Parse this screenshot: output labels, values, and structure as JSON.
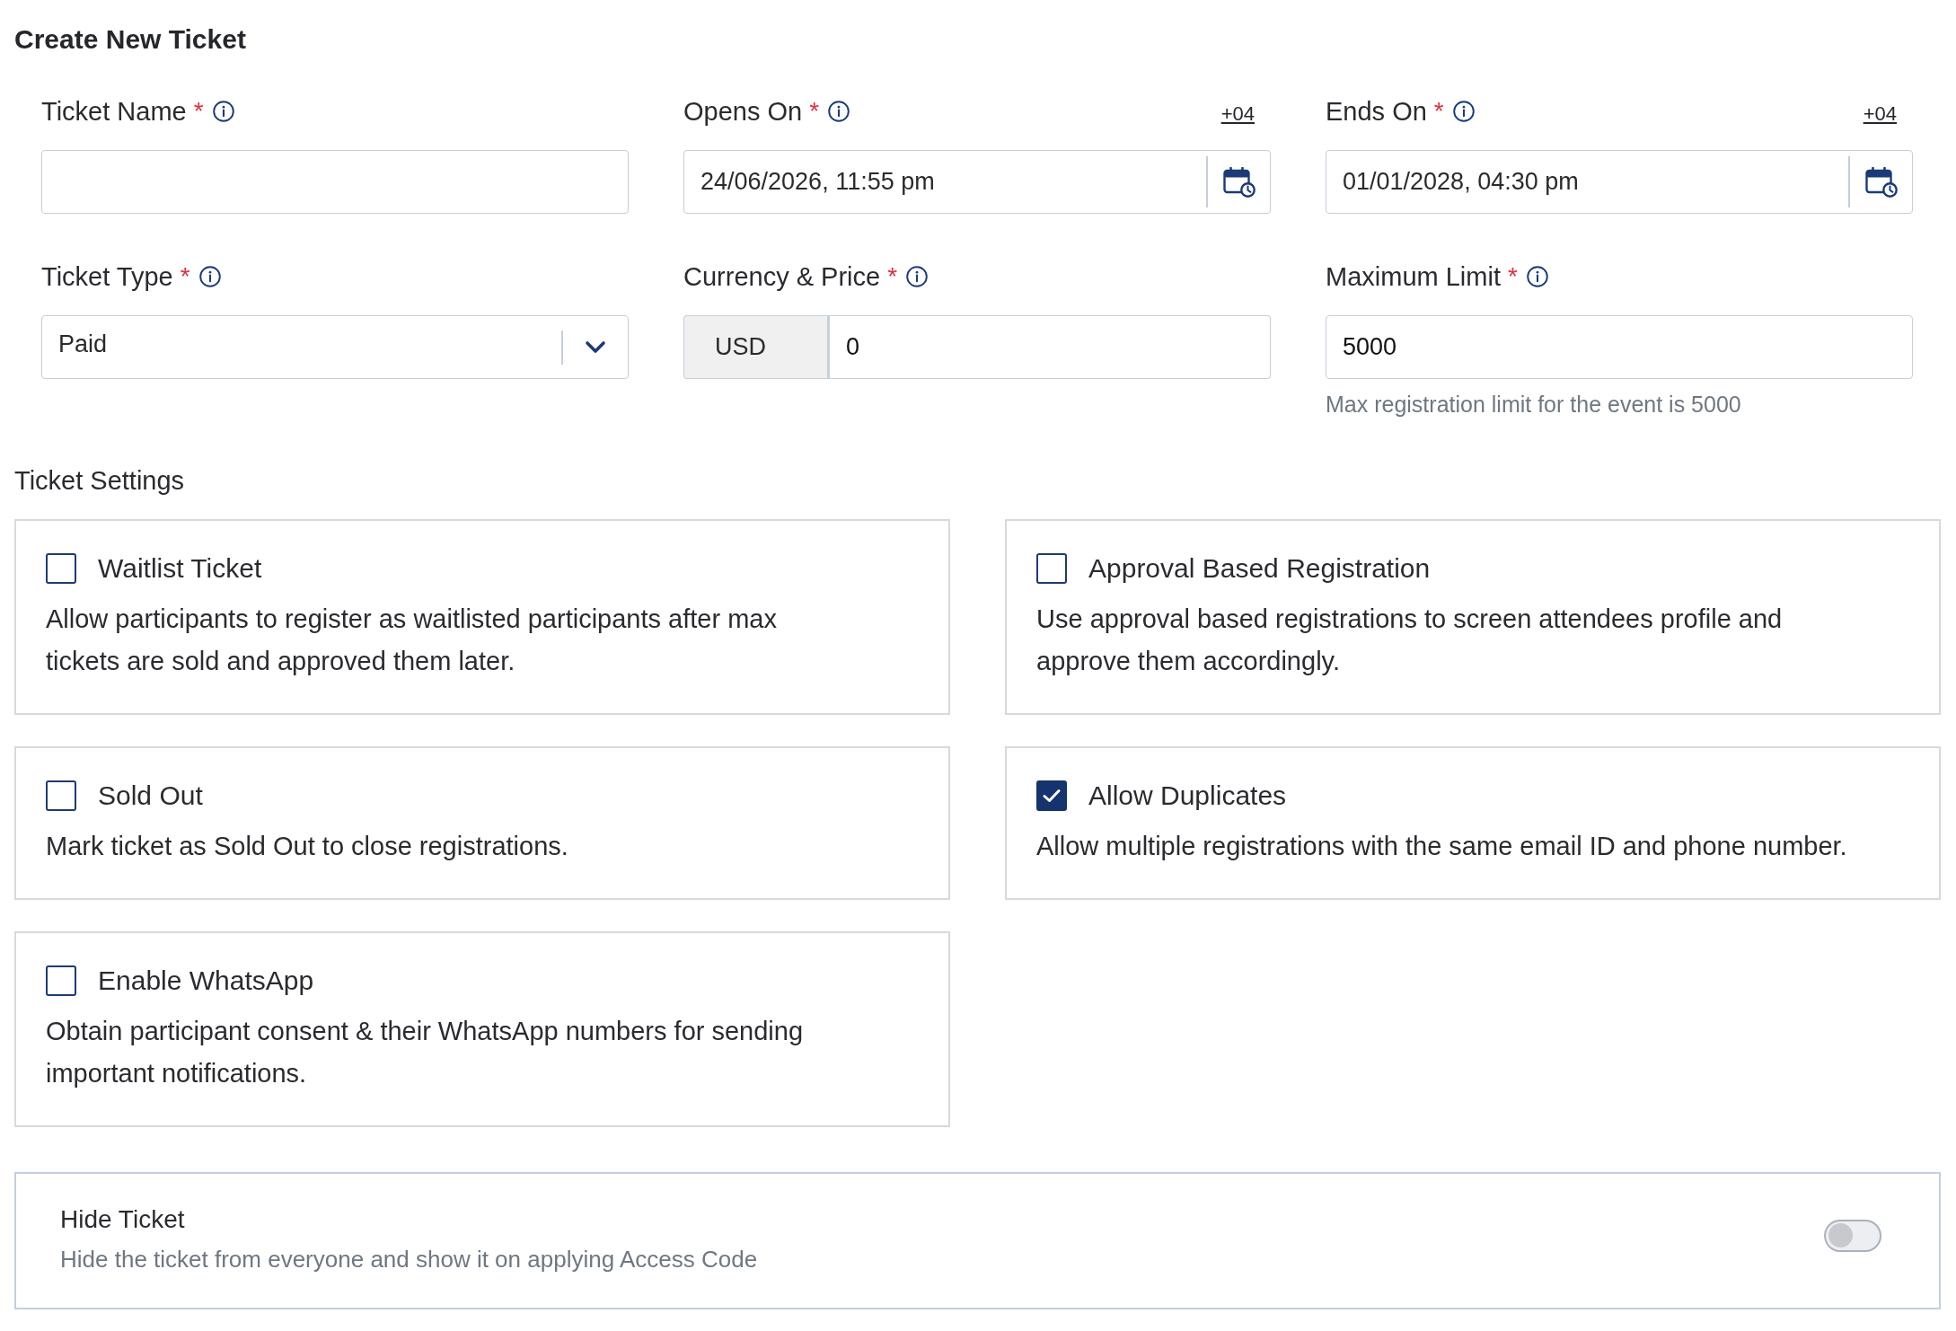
{
  "title": "Create New Ticket",
  "fields": [
    {
      "kind": "text",
      "label": "Ticket Name",
      "required_mark": "*"
    },
    {
      "kind": "datetime",
      "label": "Opens On",
      "required_mark": "*",
      "timezone": "+04",
      "value": "24/06/2026, 11:55 pm"
    },
    {
      "kind": "datetime",
      "label": "Ends On",
      "required_mark": "*",
      "timezone": "+04",
      "value": "01/01/2028, 04:30 pm"
    },
    {
      "kind": "select",
      "label": "Ticket Type",
      "required_mark": "*",
      "value": "Paid"
    },
    {
      "kind": "currency",
      "label": "Currency & Price",
      "required_mark": "*",
      "currency": "USD",
      "value": "0"
    },
    {
      "kind": "text",
      "label": "Maximum Limit",
      "required_mark": "*",
      "value": "5000",
      "hint": "Max registration limit for the event is 5000"
    }
  ],
  "settings": {
    "title": "Ticket Settings",
    "options": [
      {
        "label": "Waitlist Ticket",
        "description": "Allow participants to register as waitlisted participants after max\ntickets are sold and approved them later.",
        "checked": false
      },
      {
        "label": "Approval Based Registration",
        "description": "Use approval based registrations to screen attendees profile and\napprove them accordingly.",
        "checked": false
      },
      {
        "label": "Sold Out",
        "description": "Mark ticket as Sold Out to close registrations.",
        "checked": false
      },
      {
        "label": "Allow Duplicates",
        "description": "Allow multiple registrations with the same email ID and phone number.",
        "checked": true
      },
      {
        "label": "Enable WhatsApp",
        "description": "Obtain participant consent & their WhatsApp numbers for sending\nimportant notifications.",
        "checked": false
      }
    ]
  },
  "hide_ticket": {
    "title": "Hide Ticket",
    "description": "Hide the ticket from everyone and show it on applying Access Code",
    "on": false
  }
}
